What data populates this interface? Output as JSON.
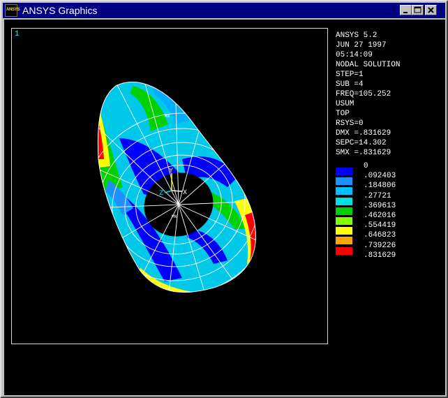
{
  "window": {
    "title": "ANSYS Graphics",
    "app_icon_text": "ANSYS"
  },
  "controls": {
    "minimize": "minimize",
    "maximize": "maximize",
    "close": "close"
  },
  "viewport": {
    "window_number": "1"
  },
  "info": {
    "lines": [
      "ANSYS 5.2",
      "JUN 27 1997",
      "05:14:09",
      "NODAL SOLUTION",
      "STEP=1",
      "SUB =4",
      "FREQ=105.252",
      "USUM",
      "TOP",
      "RSYS=0",
      "DMX =.831629",
      "SEPC=14.302",
      "SMX =.831629"
    ]
  },
  "legend": {
    "colors": [
      "#0000ff",
      "#1e90ff",
      "#00bfff",
      "#00e0e0",
      "#00d000",
      "#80ff00",
      "#ffff00",
      "#ffa500",
      "#ff0000"
    ],
    "labels": [
      "0",
      ".092403",
      ".184806",
      ".27721",
      ".369613",
      ".462016",
      ".554419",
      ".646823",
      ".739226",
      ".831629"
    ]
  },
  "triad": {
    "x": "X",
    "y": "Y",
    "z": "Z"
  },
  "plot_labels": {
    "mx": "MX",
    "mn": "MN"
  }
}
